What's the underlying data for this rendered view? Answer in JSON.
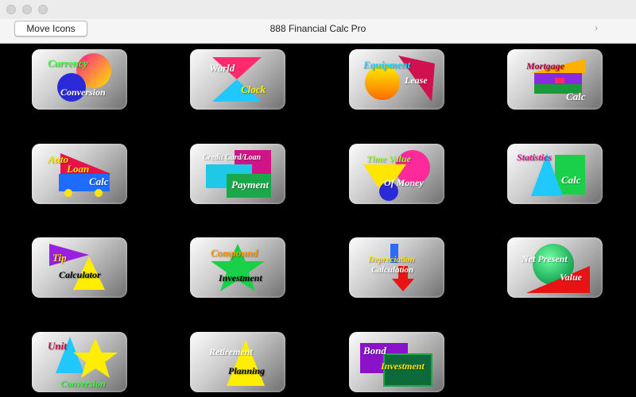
{
  "window": {
    "title": "888 Financial Calc Pro"
  },
  "toolbar": {
    "move_icons_label": "Move Icons",
    "chevron": "›"
  },
  "tiles": [
    {
      "id": "currency-conversion",
      "labels": [
        "Currency",
        "Conversion"
      ]
    },
    {
      "id": "world-clock",
      "labels": [
        "World",
        "Clock"
      ]
    },
    {
      "id": "equipment-lease",
      "labels": [
        "Equipment",
        "Lease"
      ]
    },
    {
      "id": "mortgage-calc",
      "labels": [
        "Mortgage",
        "Calc"
      ]
    },
    {
      "id": "auto-loan-calc",
      "labels": [
        "Auto",
        "Loan",
        "Calc"
      ]
    },
    {
      "id": "credit-card-loan-payment",
      "labels": [
        "Credit Card/Loan",
        "Payment"
      ]
    },
    {
      "id": "time-value-of-money",
      "labels": [
        "Time Value",
        "Of Money"
      ]
    },
    {
      "id": "statistics-calc",
      "labels": [
        "Statistics",
        "Calc"
      ]
    },
    {
      "id": "tip-calculator",
      "labels": [
        "Tip",
        "Calculator"
      ]
    },
    {
      "id": "compound-investment",
      "labels": [
        "Compound",
        "Investment"
      ]
    },
    {
      "id": "depreciation-calculation",
      "labels": [
        "Depreciation",
        "Calculation"
      ]
    },
    {
      "id": "net-present-value",
      "labels": [
        "Net Present",
        "Value"
      ]
    },
    {
      "id": "unit-conversion",
      "labels": [
        "Unit",
        "Conversion"
      ]
    },
    {
      "id": "retirement-planning",
      "labels": [
        "Retirement",
        "Planning"
      ]
    },
    {
      "id": "bond-investment",
      "labels": [
        "Bond",
        "Investment"
      ]
    }
  ]
}
